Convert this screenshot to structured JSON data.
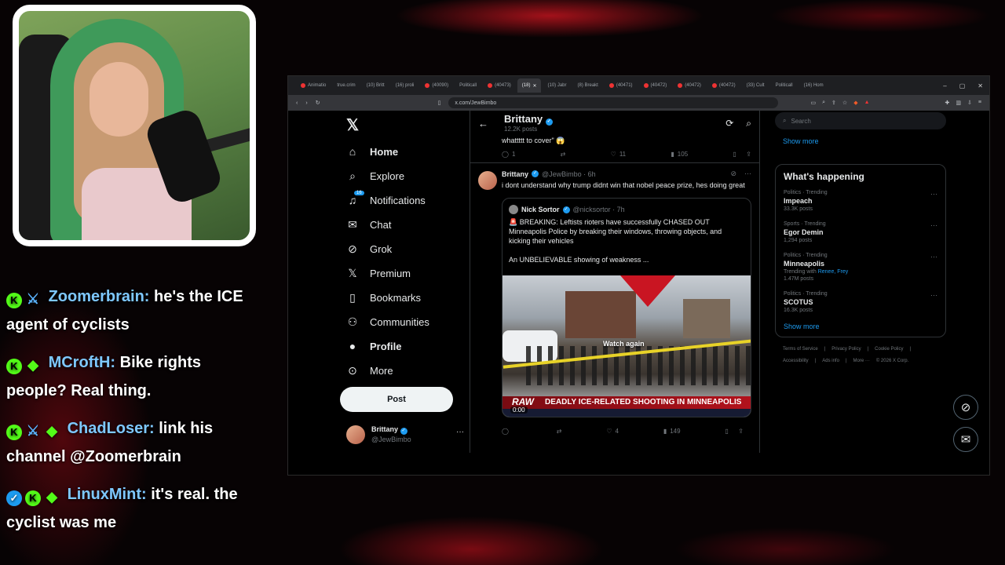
{
  "webcam": {
    "label": "streamer-webcam"
  },
  "chat": [
    {
      "badges": [
        "green",
        "sword"
      ],
      "user": "Zoomerbrain:",
      "text": "he's the ICE agent of cyclists"
    },
    {
      "badges": [
        "green",
        "diamond"
      ],
      "user": "MCroftH:",
      "text": "Bike rights people? Real thing."
    },
    {
      "badges": [
        "green",
        "sword",
        "diamond"
      ],
      "user": "ChadLoser:",
      "text": "link his channel @Zoomerbrain"
    },
    {
      "badges": [
        "verified",
        "green",
        "diamond"
      ],
      "user": "LinuxMint:",
      "text": "it's real. the cyclist was me"
    }
  ],
  "browser": {
    "tabs": [
      "Animatio",
      "true.crim",
      "(10) Britt",
      "(16) proli",
      "(40090)",
      "Politicall",
      "(40473)",
      "(18)",
      "(10) Jabr",
      "(8) Breakt",
      "(40471)",
      "(40472)",
      "(40472)",
      "(40472)",
      "(33) Cult",
      "Politicall",
      "(16) Hom"
    ],
    "active_tab_index": 7,
    "url": "x.com/JewBimbo",
    "window_controls": [
      "–",
      "▢",
      "✕"
    ]
  },
  "nav": {
    "logo": "𝕏",
    "items": [
      {
        "label": "Home",
        "icon": "⌂"
      },
      {
        "label": "Explore",
        "icon": "⌕"
      },
      {
        "label": "Notifications",
        "icon": "♫",
        "badge": "16"
      },
      {
        "label": "Chat",
        "icon": "✉"
      },
      {
        "label": "Grok",
        "icon": "⊘"
      },
      {
        "label": "Premium",
        "icon": "𝕏"
      },
      {
        "label": "Bookmarks",
        "icon": "🔖"
      },
      {
        "label": "Communities",
        "icon": "👥"
      },
      {
        "label": "Profile",
        "icon": "👤"
      },
      {
        "label": "More",
        "icon": "⋯"
      }
    ],
    "post_label": "Post",
    "account": {
      "name": "Brittany",
      "handle": "@JewBimbo"
    }
  },
  "feed": {
    "header_name": "Brittany",
    "header_posts": "12.2K posts",
    "prev_tweet_text": "whattttt to cover\" 😱",
    "prev_actions": {
      "reply": "1",
      "retweet": "",
      "like": "11",
      "views": "105"
    },
    "tweet": {
      "name": "Brittany",
      "handle": "@JewBimbo · 6h",
      "text": "i dont understand why trump didnt win that nobel peace prize, hes doing great",
      "quote": {
        "name": "Nick Sortor",
        "handle": "@nicksortor · 7h",
        "text": "🚨 BREAKING: Leftists rioters have successfully CHASED OUT Minneapolis Police by breaking their windows, throwing objects, and kicking their vehicles",
        "text2": "An UNBELIEVABLE showing of weakness ...",
        "video": {
          "overlay": "Watch again",
          "raw": "RAW",
          "headline": "DEADLY ICE-RELATED SHOOTING IN MINNEAPOLIS",
          "timecode": "0:00"
        }
      },
      "actions": {
        "reply": "",
        "retweet": "",
        "like": "4",
        "views": "149"
      }
    }
  },
  "rail": {
    "search_placeholder": "Search",
    "show_more": "Show more",
    "whats_happening": "What's happening",
    "trends": [
      {
        "category": "Politics · Trending",
        "name": "Impeach",
        "count": "33.3K posts"
      },
      {
        "category": "Sports · Trending",
        "name": "Egor Demin",
        "count": "1,294 posts"
      },
      {
        "category": "Politics · Trending",
        "name": "Minneapolis",
        "with_prefix": "Trending with",
        "with_links": "Renee, Frey",
        "count": "1.47M posts"
      },
      {
        "category": "Politics · Trending",
        "name": "SCOTUS",
        "count": "16.3K posts"
      }
    ],
    "show_more_bottom": "Show more",
    "footer": [
      "Terms of Service",
      "|",
      "Privacy Policy",
      "|",
      "Cookie Policy",
      "|",
      "Accessibility",
      "|",
      "Ads info",
      "|",
      "More ···",
      "© 2026 X Corp."
    ]
  }
}
